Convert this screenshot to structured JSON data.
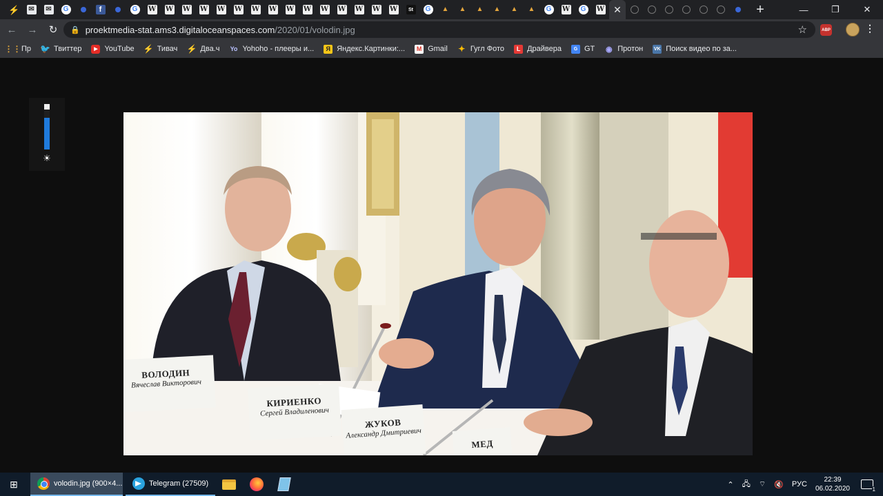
{
  "browser": {
    "tabs": [
      {
        "icon": "lightning-icon",
        "glyph": "⚡",
        "cls": "lightning"
      },
      {
        "icon": "mail-icon",
        "glyph": "✉",
        "cls": "mail"
      },
      {
        "icon": "mail-icon",
        "glyph": "✉",
        "cls": "mail"
      },
      {
        "icon": "google-icon",
        "glyph": "G",
        "cls": "google"
      },
      {
        "icon": "dot-icon",
        "glyph": "",
        "cls": "dot"
      },
      {
        "icon": "facebook-icon",
        "glyph": "f",
        "cls": "fb"
      },
      {
        "icon": "dot-icon",
        "glyph": "",
        "cls": "dot"
      },
      {
        "icon": "google-icon",
        "glyph": "G",
        "cls": "google"
      },
      {
        "icon": "wikipedia-icon",
        "glyph": "W",
        "cls": "wiki"
      },
      {
        "icon": "wikipedia-icon",
        "glyph": "W",
        "cls": "wiki"
      },
      {
        "icon": "wikipedia-icon",
        "glyph": "W",
        "cls": "wiki"
      },
      {
        "icon": "wikipedia-icon",
        "glyph": "W",
        "cls": "wiki"
      },
      {
        "icon": "wikipedia-icon",
        "glyph": "W",
        "cls": "wiki"
      },
      {
        "icon": "wikipedia-icon",
        "glyph": "W",
        "cls": "wiki"
      },
      {
        "icon": "wikipedia-icon",
        "glyph": "W",
        "cls": "wiki"
      },
      {
        "icon": "wikipedia-icon",
        "glyph": "W",
        "cls": "wiki"
      },
      {
        "icon": "wikipedia-icon",
        "glyph": "W",
        "cls": "wiki"
      },
      {
        "icon": "wikipedia-icon",
        "glyph": "W",
        "cls": "wiki"
      },
      {
        "icon": "wikipedia-icon",
        "glyph": "W",
        "cls": "wiki"
      },
      {
        "icon": "wikipedia-icon",
        "glyph": "W",
        "cls": "wiki"
      },
      {
        "icon": "wikipedia-icon",
        "glyph": "W",
        "cls": "wiki"
      },
      {
        "icon": "wikipedia-icon",
        "glyph": "W",
        "cls": "wiki"
      },
      {
        "icon": "wikipedia-icon",
        "glyph": "W",
        "cls": "wiki"
      },
      {
        "icon": "st-icon",
        "glyph": "St",
        "cls": "st"
      },
      {
        "icon": "google-icon",
        "glyph": "G",
        "cls": "google"
      },
      {
        "icon": "triangle-icon",
        "glyph": "▲",
        "cls": "tri"
      },
      {
        "icon": "triangle-icon",
        "glyph": "▲",
        "cls": "tri"
      },
      {
        "icon": "triangle-icon",
        "glyph": "▲",
        "cls": "tri"
      },
      {
        "icon": "triangle-icon",
        "glyph": "▲",
        "cls": "tri"
      },
      {
        "icon": "triangle-icon",
        "glyph": "▲",
        "cls": "tri"
      },
      {
        "icon": "triangle-icon",
        "glyph": "▲",
        "cls": "tri"
      },
      {
        "icon": "google-icon",
        "glyph": "G",
        "cls": "google"
      },
      {
        "icon": "wikipedia-icon",
        "glyph": "W",
        "cls": "wiki"
      },
      {
        "icon": "google-icon",
        "glyph": "G",
        "cls": "google"
      },
      {
        "icon": "wikipedia-icon",
        "glyph": "W",
        "cls": "wiki"
      }
    ],
    "tabs_after": [
      {
        "icon": "loading-icon",
        "cls": "ghost"
      },
      {
        "icon": "loading-icon",
        "cls": "ghost"
      },
      {
        "icon": "loading-icon",
        "cls": "ghost"
      },
      {
        "icon": "loading-icon",
        "cls": "ghost"
      },
      {
        "icon": "loading-icon",
        "cls": "ghost"
      },
      {
        "icon": "loading-icon",
        "cls": "ghost"
      },
      {
        "icon": "dot-icon",
        "cls": "dot"
      }
    ],
    "active_tab_close": "✕",
    "new_tab": "+",
    "window_controls": {
      "minimize": "—",
      "maximize": "❐",
      "close": "✕"
    },
    "nav": {
      "back": "←",
      "forward": "→",
      "reload": "↻"
    },
    "url": {
      "host": "proektmedia-stat.ams3.digitaloceanspaces.com",
      "path": "/2020/01/volodin.jpg"
    },
    "star": "☆",
    "abp": "ABP",
    "menu": "⋮"
  },
  "bookmarks": [
    {
      "label": "Пр",
      "icon": "apps-icon",
      "glyph": "⋮⋮",
      "cls": "apps"
    },
    {
      "label": "Твиттер",
      "icon": "twitter-icon",
      "glyph": "🐦",
      "cls": "tw"
    },
    {
      "label": "YouTube",
      "icon": "youtube-icon",
      "glyph": "▶",
      "cls": "yt"
    },
    {
      "label": "Тивач",
      "icon": "lightning-icon",
      "glyph": "⚡",
      "cls": "bolt"
    },
    {
      "label": "Два.ч",
      "icon": "lightning-icon",
      "glyph": "⚡",
      "cls": "bolt"
    },
    {
      "label": "Yohoho - плееры и...",
      "icon": "yo-icon",
      "glyph": "Yo",
      "cls": "yo"
    },
    {
      "label": "Яндекс.Картинки:...",
      "icon": "yandex-images-icon",
      "glyph": "Я",
      "cls": "ya"
    },
    {
      "label": "Gmail",
      "icon": "gmail-icon",
      "glyph": "M",
      "cls": "gm"
    },
    {
      "label": "Гугл Фото",
      "icon": "google-photos-icon",
      "glyph": "✦",
      "cls": "gp"
    },
    {
      "label": "Драйвера",
      "icon": "l-icon",
      "glyph": "L",
      "cls": "l"
    },
    {
      "label": "GT",
      "icon": "google-translate-icon",
      "glyph": "G",
      "cls": "gt"
    },
    {
      "label": "Протон",
      "icon": "proton-icon",
      "glyph": "◉",
      "cls": "pr"
    },
    {
      "label": "Поиск видео по за...",
      "icon": "vk-icon",
      "glyph": "VK",
      "cls": "vk"
    }
  ],
  "viewer": {
    "brightness_level": 0.82,
    "brightness_icon": "☀"
  },
  "photo": {
    "placards": [
      {
        "name": "ВОЛОДИН",
        "sub": "Вячеслав Викторович"
      },
      {
        "name": "КИРИЕНКО",
        "sub": "Сергей Владиленович"
      },
      {
        "name": "ЖУКОВ",
        "sub": "Александр Дмитриевич"
      },
      {
        "name": "МЕД",
        "sub": ""
      }
    ]
  },
  "taskbar": {
    "start": "⊞",
    "apps": [
      {
        "label": "volodin.jpg (900×4...",
        "icon": "chrome-icon"
      },
      {
        "label": "Telegram (27509)",
        "icon": "telegram-icon"
      }
    ],
    "tray": {
      "chevron": "⌃",
      "network": "🖧",
      "wifi": "⌔",
      "volume": "🔇",
      "lang": "РУС",
      "time": "22:39",
      "date": "06.02.2020",
      "notifications": "1"
    }
  }
}
